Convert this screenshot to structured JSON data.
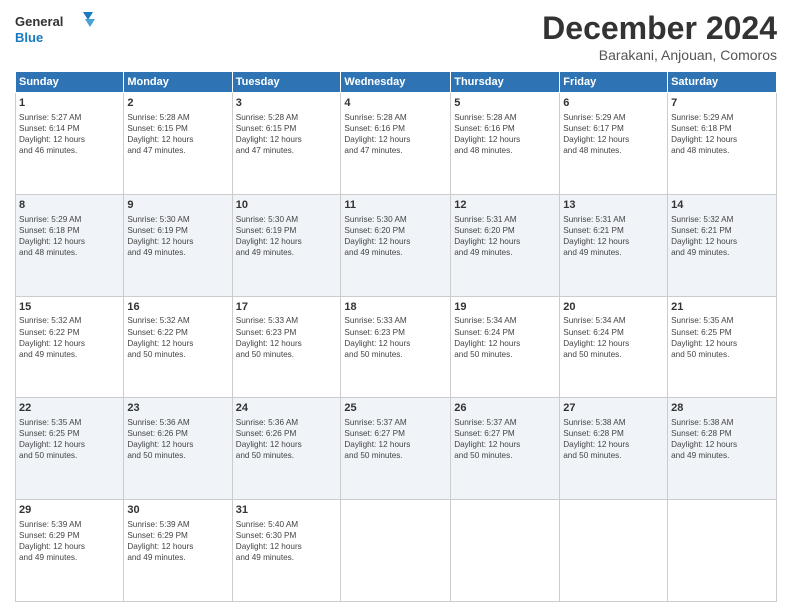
{
  "header": {
    "logo_line1": "General",
    "logo_line2": "Blue",
    "month_title": "December 2024",
    "subtitle": "Barakani, Anjouan, Comoros"
  },
  "calendar": {
    "headers": [
      "Sunday",
      "Monday",
      "Tuesday",
      "Wednesday",
      "Thursday",
      "Friday",
      "Saturday"
    ],
    "weeks": [
      [
        {
          "day": "",
          "info": ""
        },
        {
          "day": "2",
          "info": "Sunrise: 5:28 AM\nSunset: 6:15 PM\nDaylight: 12 hours\nand 47 minutes."
        },
        {
          "day": "3",
          "info": "Sunrise: 5:28 AM\nSunset: 6:15 PM\nDaylight: 12 hours\nand 47 minutes."
        },
        {
          "day": "4",
          "info": "Sunrise: 5:28 AM\nSunset: 6:16 PM\nDaylight: 12 hours\nand 47 minutes."
        },
        {
          "day": "5",
          "info": "Sunrise: 5:28 AM\nSunset: 6:16 PM\nDaylight: 12 hours\nand 48 minutes."
        },
        {
          "day": "6",
          "info": "Sunrise: 5:29 AM\nSunset: 6:17 PM\nDaylight: 12 hours\nand 48 minutes."
        },
        {
          "day": "7",
          "info": "Sunrise: 5:29 AM\nSunset: 6:18 PM\nDaylight: 12 hours\nand 48 minutes."
        }
      ],
      [
        {
          "day": "1",
          "info": "Sunrise: 5:27 AM\nSunset: 6:14 PM\nDaylight: 12 hours\nand 46 minutes."
        },
        {
          "day": "",
          "info": ""
        },
        {
          "day": "",
          "info": ""
        },
        {
          "day": "",
          "info": ""
        },
        {
          "day": "",
          "info": ""
        },
        {
          "day": "",
          "info": ""
        },
        {
          "day": "",
          "info": ""
        }
      ],
      [
        {
          "day": "8",
          "info": "Sunrise: 5:29 AM\nSunset: 6:18 PM\nDaylight: 12 hours\nand 48 minutes."
        },
        {
          "day": "9",
          "info": "Sunrise: 5:30 AM\nSunset: 6:19 PM\nDaylight: 12 hours\nand 49 minutes."
        },
        {
          "day": "10",
          "info": "Sunrise: 5:30 AM\nSunset: 6:19 PM\nDaylight: 12 hours\nand 49 minutes."
        },
        {
          "day": "11",
          "info": "Sunrise: 5:30 AM\nSunset: 6:20 PM\nDaylight: 12 hours\nand 49 minutes."
        },
        {
          "day": "12",
          "info": "Sunrise: 5:31 AM\nSunset: 6:20 PM\nDaylight: 12 hours\nand 49 minutes."
        },
        {
          "day": "13",
          "info": "Sunrise: 5:31 AM\nSunset: 6:21 PM\nDaylight: 12 hours\nand 49 minutes."
        },
        {
          "day": "14",
          "info": "Sunrise: 5:32 AM\nSunset: 6:21 PM\nDaylight: 12 hours\nand 49 minutes."
        }
      ],
      [
        {
          "day": "15",
          "info": "Sunrise: 5:32 AM\nSunset: 6:22 PM\nDaylight: 12 hours\nand 49 minutes."
        },
        {
          "day": "16",
          "info": "Sunrise: 5:32 AM\nSunset: 6:22 PM\nDaylight: 12 hours\nand 50 minutes."
        },
        {
          "day": "17",
          "info": "Sunrise: 5:33 AM\nSunset: 6:23 PM\nDaylight: 12 hours\nand 50 minutes."
        },
        {
          "day": "18",
          "info": "Sunrise: 5:33 AM\nSunset: 6:23 PM\nDaylight: 12 hours\nand 50 minutes."
        },
        {
          "day": "19",
          "info": "Sunrise: 5:34 AM\nSunset: 6:24 PM\nDaylight: 12 hours\nand 50 minutes."
        },
        {
          "day": "20",
          "info": "Sunrise: 5:34 AM\nSunset: 6:24 PM\nDaylight: 12 hours\nand 50 minutes."
        },
        {
          "day": "21",
          "info": "Sunrise: 5:35 AM\nSunset: 6:25 PM\nDaylight: 12 hours\nand 50 minutes."
        }
      ],
      [
        {
          "day": "22",
          "info": "Sunrise: 5:35 AM\nSunset: 6:25 PM\nDaylight: 12 hours\nand 50 minutes."
        },
        {
          "day": "23",
          "info": "Sunrise: 5:36 AM\nSunset: 6:26 PM\nDaylight: 12 hours\nand 50 minutes."
        },
        {
          "day": "24",
          "info": "Sunrise: 5:36 AM\nSunset: 6:26 PM\nDaylight: 12 hours\nand 50 minutes."
        },
        {
          "day": "25",
          "info": "Sunrise: 5:37 AM\nSunset: 6:27 PM\nDaylight: 12 hours\nand 50 minutes."
        },
        {
          "day": "26",
          "info": "Sunrise: 5:37 AM\nSunset: 6:27 PM\nDaylight: 12 hours\nand 50 minutes."
        },
        {
          "day": "27",
          "info": "Sunrise: 5:38 AM\nSunset: 6:28 PM\nDaylight: 12 hours\nand 50 minutes."
        },
        {
          "day": "28",
          "info": "Sunrise: 5:38 AM\nSunset: 6:28 PM\nDaylight: 12 hours\nand 49 minutes."
        }
      ],
      [
        {
          "day": "29",
          "info": "Sunrise: 5:39 AM\nSunset: 6:29 PM\nDaylight: 12 hours\nand 49 minutes."
        },
        {
          "day": "30",
          "info": "Sunrise: 5:39 AM\nSunset: 6:29 PM\nDaylight: 12 hours\nand 49 minutes."
        },
        {
          "day": "31",
          "info": "Sunrise: 5:40 AM\nSunset: 6:30 PM\nDaylight: 12 hours\nand 49 minutes."
        },
        {
          "day": "",
          "info": ""
        },
        {
          "day": "",
          "info": ""
        },
        {
          "day": "",
          "info": ""
        },
        {
          "day": "",
          "info": ""
        }
      ]
    ]
  }
}
